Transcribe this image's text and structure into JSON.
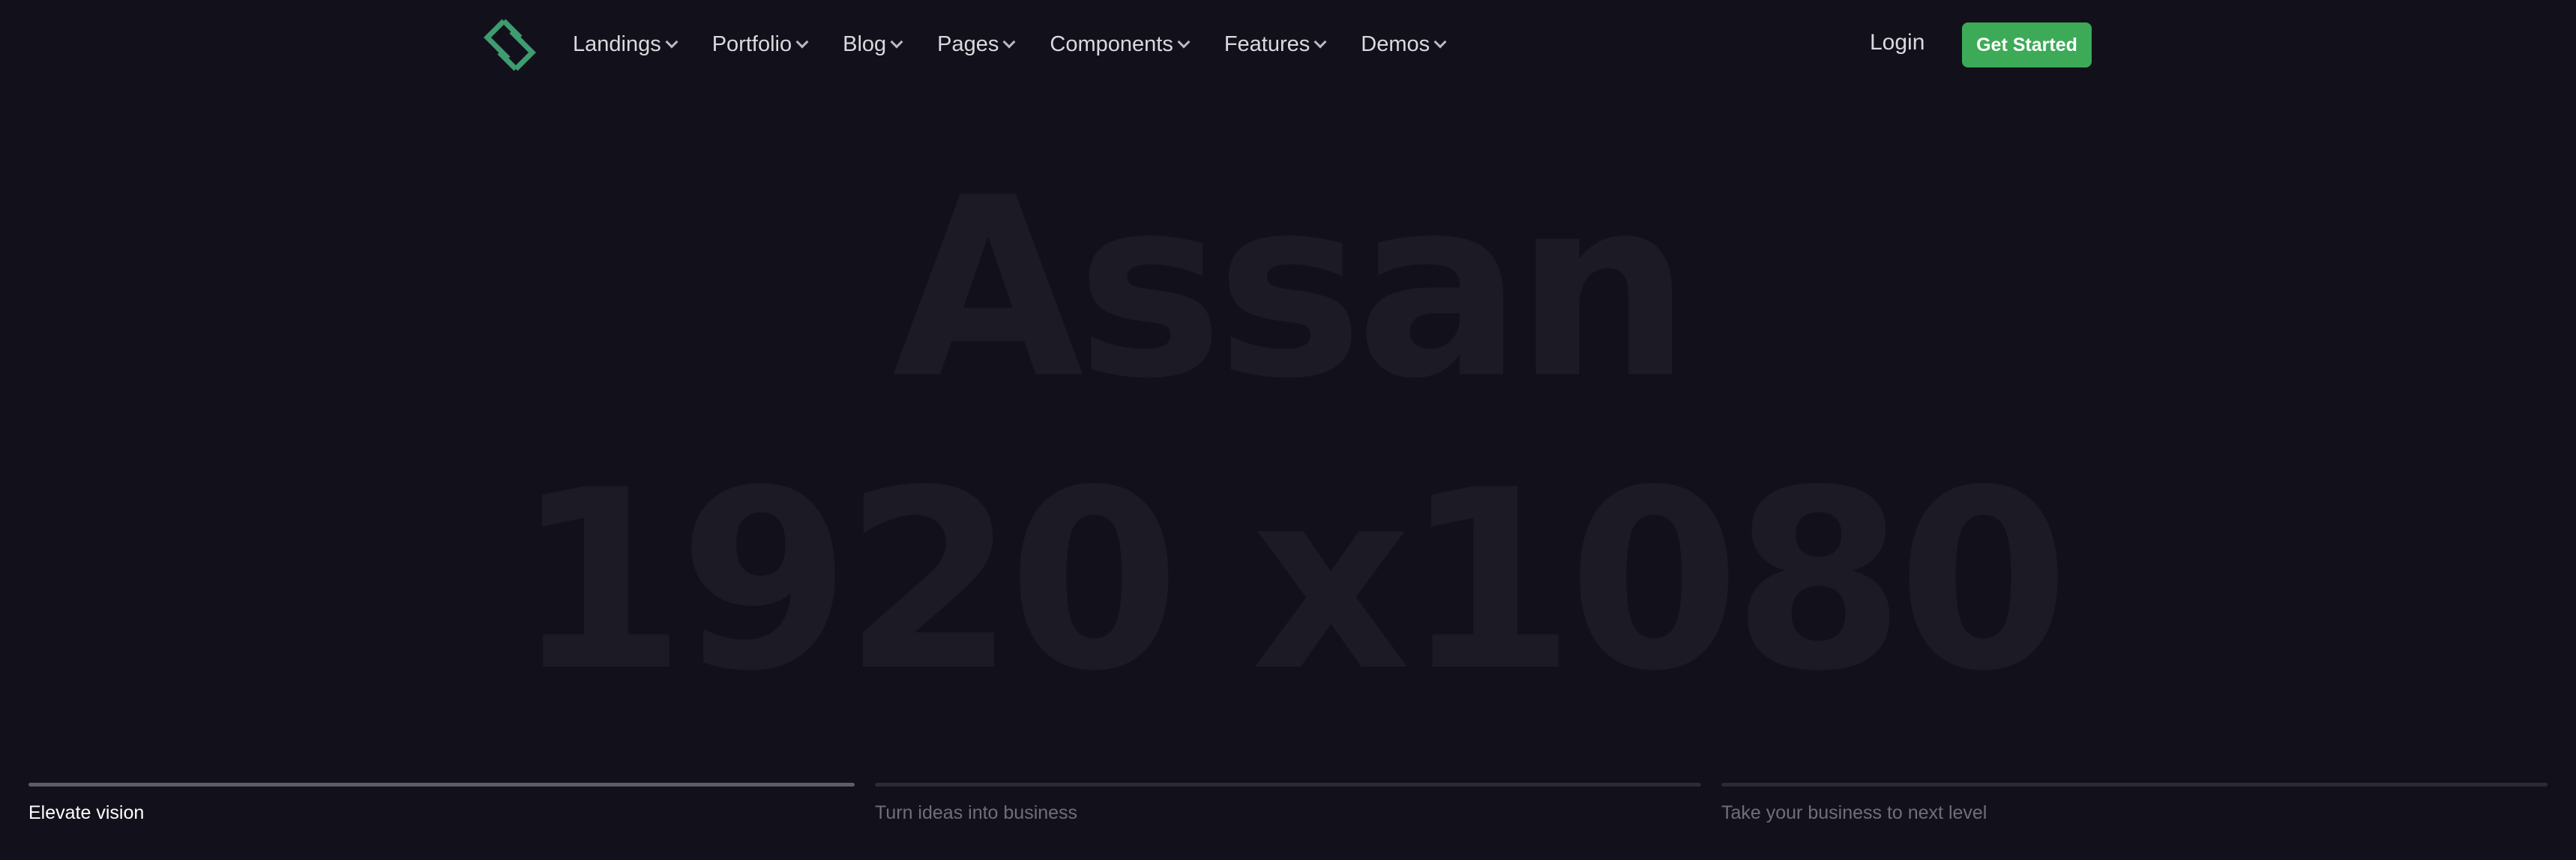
{
  "nav": {
    "logo_icon": "brand-logo-icon",
    "items": [
      {
        "label": "Landings"
      },
      {
        "label": "Portfolio"
      },
      {
        "label": "Blog"
      },
      {
        "label": "Pages"
      },
      {
        "label": "Components"
      },
      {
        "label": "Features"
      },
      {
        "label": "Demos"
      }
    ],
    "login_label": "Login",
    "cta_label": "Get Started"
  },
  "hero": {
    "line1": "Assan",
    "line2": "1920 x1080"
  },
  "tabs": [
    {
      "label": "Elevate vision",
      "active": true,
      "progress": 1.0
    },
    {
      "label": "Turn ideas into business",
      "active": false,
      "progress": 0
    },
    {
      "label": "Take your business to next level",
      "active": false,
      "progress": 0
    }
  ],
  "colors": {
    "background": "#12111b",
    "accent": "#3daa57",
    "logo": "#3e9c70"
  }
}
